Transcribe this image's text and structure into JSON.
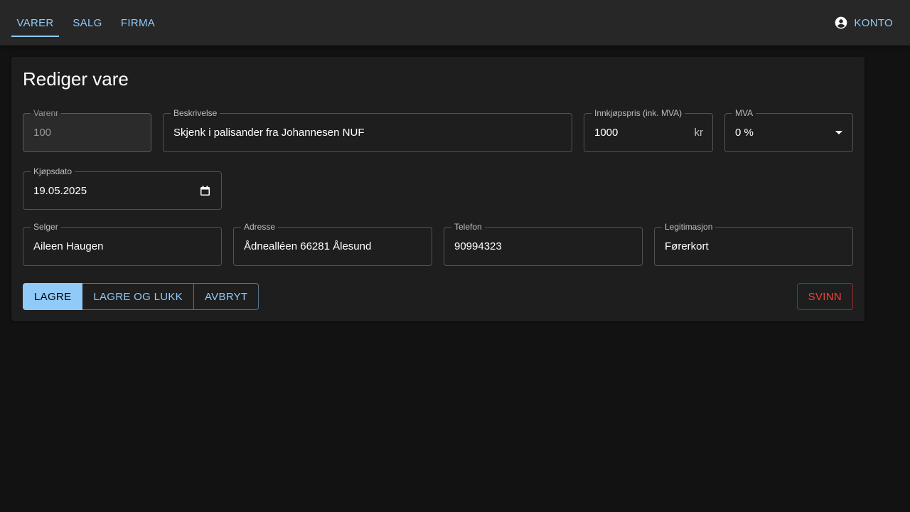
{
  "nav": {
    "tabs": [
      {
        "label": "VARER"
      },
      {
        "label": "SALG"
      },
      {
        "label": "FIRMA"
      }
    ],
    "account_label": "KONTO"
  },
  "form": {
    "title": "Rediger vare",
    "varenr": {
      "label": "Varenr",
      "value": "100"
    },
    "beskrivelse": {
      "label": "Beskrivelse",
      "value": "Skjenk i palisander fra Johannesen NUF"
    },
    "innkjopspris": {
      "label": "Innkjøpspris (ink. MVA)",
      "value": "1000",
      "unit": "kr"
    },
    "mva": {
      "label": "MVA",
      "value": "0 %"
    },
    "kjopsdato": {
      "label": "Kjøpsdato",
      "value": "19.05.2025"
    },
    "selger": {
      "label": "Selger",
      "value": "Aileen Haugen"
    },
    "adresse": {
      "label": "Adresse",
      "value": "Ådnealléen 66281 Ålesund"
    },
    "telefon": {
      "label": "Telefon",
      "value": "90994323"
    },
    "legitimasjon": {
      "label": "Legitimasjon",
      "value": "Førerkort"
    }
  },
  "actions": {
    "save": "LAGRE",
    "save_close": "LAGRE OG LUKK",
    "cancel": "AVBRYT",
    "shrinkage": "SVINN"
  },
  "colors": {
    "accent": "#90caf9",
    "danger": "#f44336",
    "background": "#121212",
    "surface": "#1e1e1e"
  }
}
